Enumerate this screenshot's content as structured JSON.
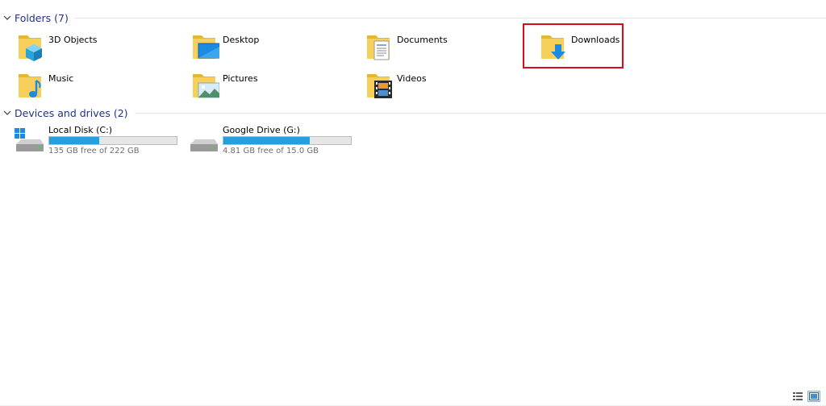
{
  "folders_group": {
    "title": "Folders (7)",
    "items": [
      {
        "label": "3D Objects",
        "icon": "3d-objects-folder-icon"
      },
      {
        "label": "Desktop",
        "icon": "desktop-folder-icon"
      },
      {
        "label": "Documents",
        "icon": "documents-folder-icon"
      },
      {
        "label": "Downloads",
        "icon": "downloads-folder-icon"
      },
      {
        "label": "Music",
        "icon": "music-folder-icon"
      },
      {
        "label": "Pictures",
        "icon": "pictures-folder-icon"
      },
      {
        "label": "Videos",
        "icon": "videos-folder-icon"
      }
    ]
  },
  "drives_group": {
    "title": "Devices and drives (2)",
    "items": [
      {
        "name": "Local Disk (C:)",
        "free_text": "135 GB free of 222 GB",
        "used_fraction": 0.39,
        "icon": "windows-disk-icon"
      },
      {
        "name": "Google Drive (G:)",
        "free_text": "4.81 GB free of 15.0 GB",
        "used_fraction": 0.68,
        "icon": "drive-icon"
      }
    ]
  },
  "colors": {
    "group_title": "#1e3287",
    "bar_fill": "#26a0da",
    "highlight": "#d50f1a",
    "folder": "#f5c542"
  },
  "view_buttons": [
    "details-view-icon",
    "large-icons-view-icon"
  ]
}
